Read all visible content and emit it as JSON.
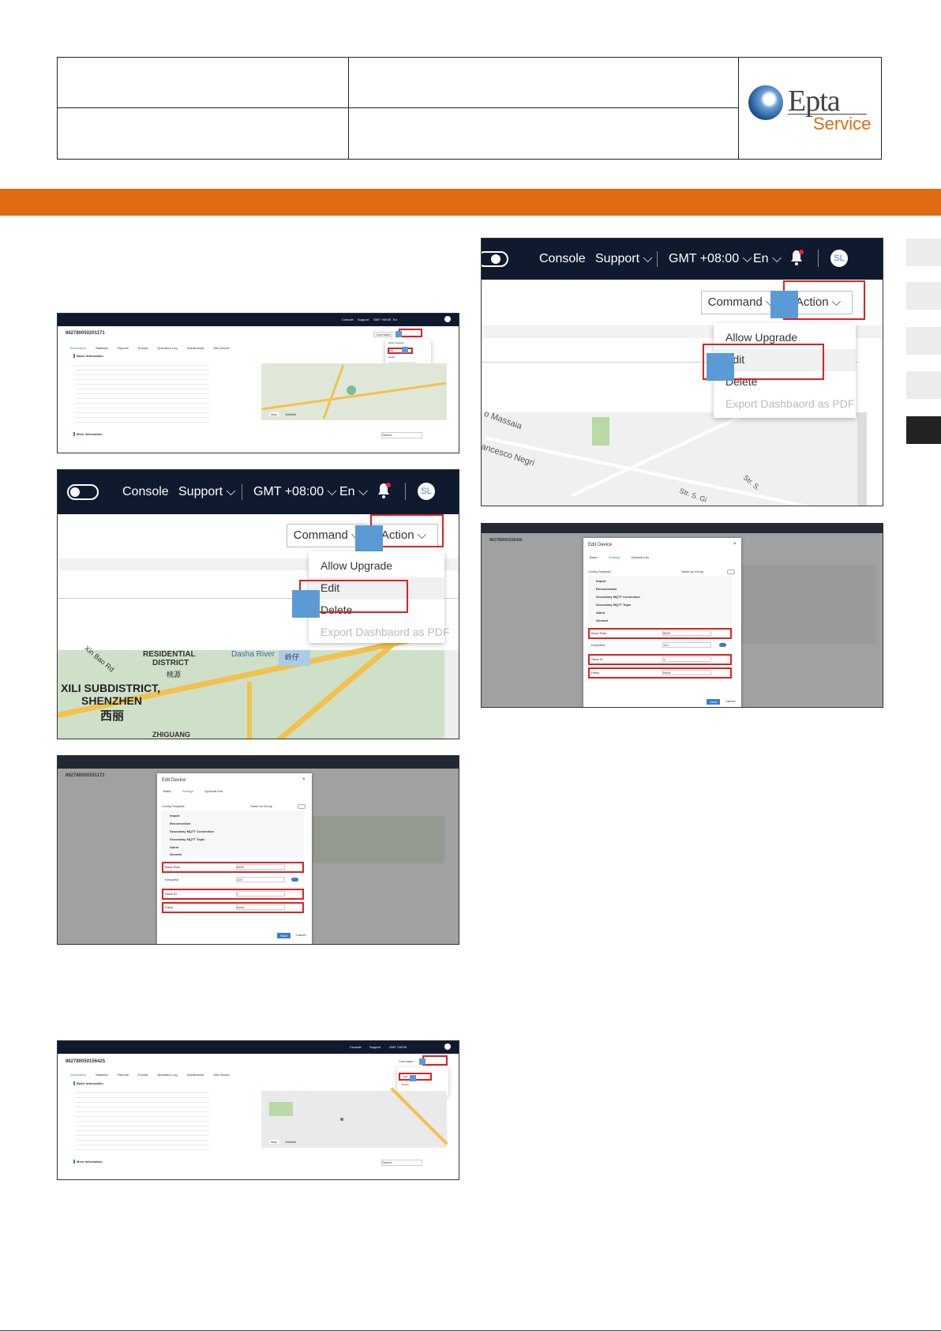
{
  "logo": {
    "word": "Epta",
    "sub": "Service"
  },
  "colors": {
    "accent": "#e06a12",
    "nav": "#0f1a2e",
    "highlight": "#5b9bd5",
    "outline": "#e02020"
  },
  "nav": {
    "console": "Console",
    "support": "Support",
    "timezone": "GMT +08:00",
    "lang": "En",
    "avatar": "SL"
  },
  "toolbar": {
    "command": "Command",
    "action": "Action"
  },
  "action_menu": {
    "allow_upgrade": "Allow Upgrade",
    "edit": "Edit",
    "delete": "Delete",
    "export": "Export Dashbaord as PDF"
  },
  "shot1": {
    "device_id": "862780050201171",
    "tabs": [
      "Information",
      "Statistics",
      "Reports",
      "Events",
      "Operation Log",
      "Dashboards",
      "Sub Device"
    ],
    "section_basic": "Basic Information",
    "section_more": "More Information",
    "map_tabs": [
      "Map",
      "Satellite"
    ],
    "search": "Search"
  },
  "shot2_map": {
    "l1": "RESIDENTIAL",
    "l2": "DISTRICT",
    "l3": "XILI SUBDISTRICT,",
    "l4": "SHENZHEN",
    "l5": "西丽",
    "l6": "ZHIGUANG",
    "l7": "Dasha River",
    "l8": "Xin Bao Rd",
    "l9": "桃源",
    "l10": "岭仔"
  },
  "edit_dialog": {
    "title": "Edit Device",
    "tabs": [
      "Basic",
      "Settings",
      "Optional Info"
    ],
    "config_template": "Config Template",
    "same_as_group": "Same as Group",
    "sections": [
      "Import",
      "Reconnection",
      "Secondary MQTT Connection",
      "Secondary MQTT Topic",
      "Alarm",
      "General"
    ],
    "fields": [
      {
        "label": "Baud Rate",
        "value": "9600"
      },
      {
        "label": "Keepalive",
        "value": "120"
      },
      {
        "label": "Slave ID",
        "value": "1"
      },
      {
        "label": "Parity",
        "value": "None"
      }
    ],
    "save": "Save",
    "cancel": "Cancel"
  },
  "shot4": {
    "device_id": "862780050156425"
  },
  "shot5_map": {
    "l1": "o Massaia",
    "l2": "ancesco Negri",
    "l3": "Str. S. Gi",
    "l4": "Str. S."
  }
}
